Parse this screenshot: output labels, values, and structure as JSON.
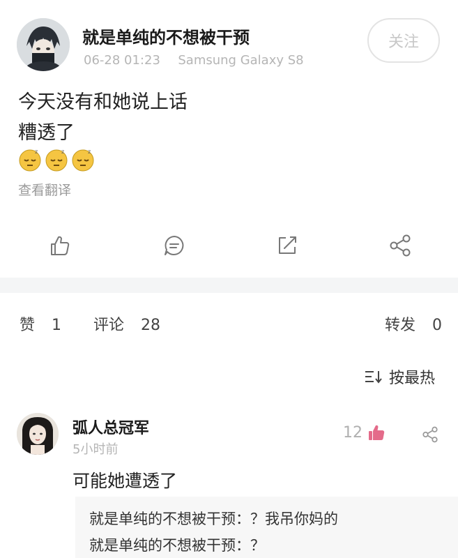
{
  "post": {
    "author": "就是单纯的不想被干预",
    "time": "06-28 01:23",
    "device": "Samsung Galaxy S8",
    "follow_label": "关注",
    "lines": [
      "今天没有和她说上话",
      "糟透了"
    ],
    "emoji_count": 3,
    "translate_label": "查看翻译"
  },
  "actions": {
    "icons": [
      "like-icon",
      "comment-icon",
      "edit-icon",
      "share-icon"
    ]
  },
  "stats": {
    "likes_label": "赞",
    "likes_count": "1",
    "comments_label": "评论",
    "comments_count": "28",
    "reposts_label": "转发",
    "reposts_count": "0"
  },
  "sort": {
    "label": "按最热"
  },
  "comment": {
    "author": "弧人总冠军",
    "time": "5小时前",
    "likes": "12",
    "text": "可能她遭透了",
    "replies": [
      {
        "author": "就是单纯的不想被干预",
        "text": "？我吊你妈的"
      },
      {
        "author": "就是单纯的不想被干预",
        "text": "？"
      }
    ]
  },
  "colors": {
    "accent_pink": "#e46b8a",
    "text_main": "#222222",
    "text_muted": "#b5b5b5",
    "icon_gray": "#888888"
  }
}
